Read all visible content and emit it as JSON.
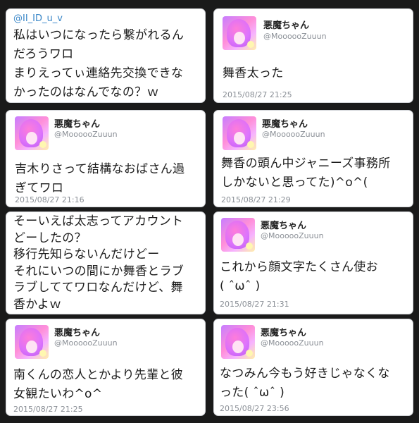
{
  "accounts": {
    "author_name": "悪魔ちゃん",
    "author_handle": "@MoooooZuuun",
    "mention_handle": "@II_ID_u_v"
  },
  "tweets": [
    {
      "text": "私はいつになったら繋がれるん\nだろうワロ\nまりえってぃ連絡先交換できな\nかったのはなんでなの？ｗ"
    },
    {
      "text": "舞香太った",
      "time": "2015/08/27 21:25"
    },
    {
      "text": "吉木りさって結構なおばさん過\nぎてワロ",
      "time": "2015/08/27 21:16"
    },
    {
      "text": "舞香の頭ん中ジャニーズ事務所\nしかないと思ってた)^o^(",
      "time": "2015/08/27 21:29"
    },
    {
      "text": "そーいえば太志ってアカウント\nどーしたの？\n移行先知らないんだけどー\nそれにいつの間にか舞香とラブ\nラブしててワロなんだけど、舞\n香かよｗ"
    },
    {
      "text": "これから顔文字たくさん使お\n( ˆωˆ )",
      "time": "2015/08/27 21:31"
    },
    {
      "text": "南くんの恋人とかより先輩と彼\n女観たいわ^o^",
      "time": "2015/08/27 21:25"
    },
    {
      "text": "なつみん今もう好きじゃなくな\nった( ˆωˆ )",
      "time": "2015/08/27 23:56"
    }
  ]
}
